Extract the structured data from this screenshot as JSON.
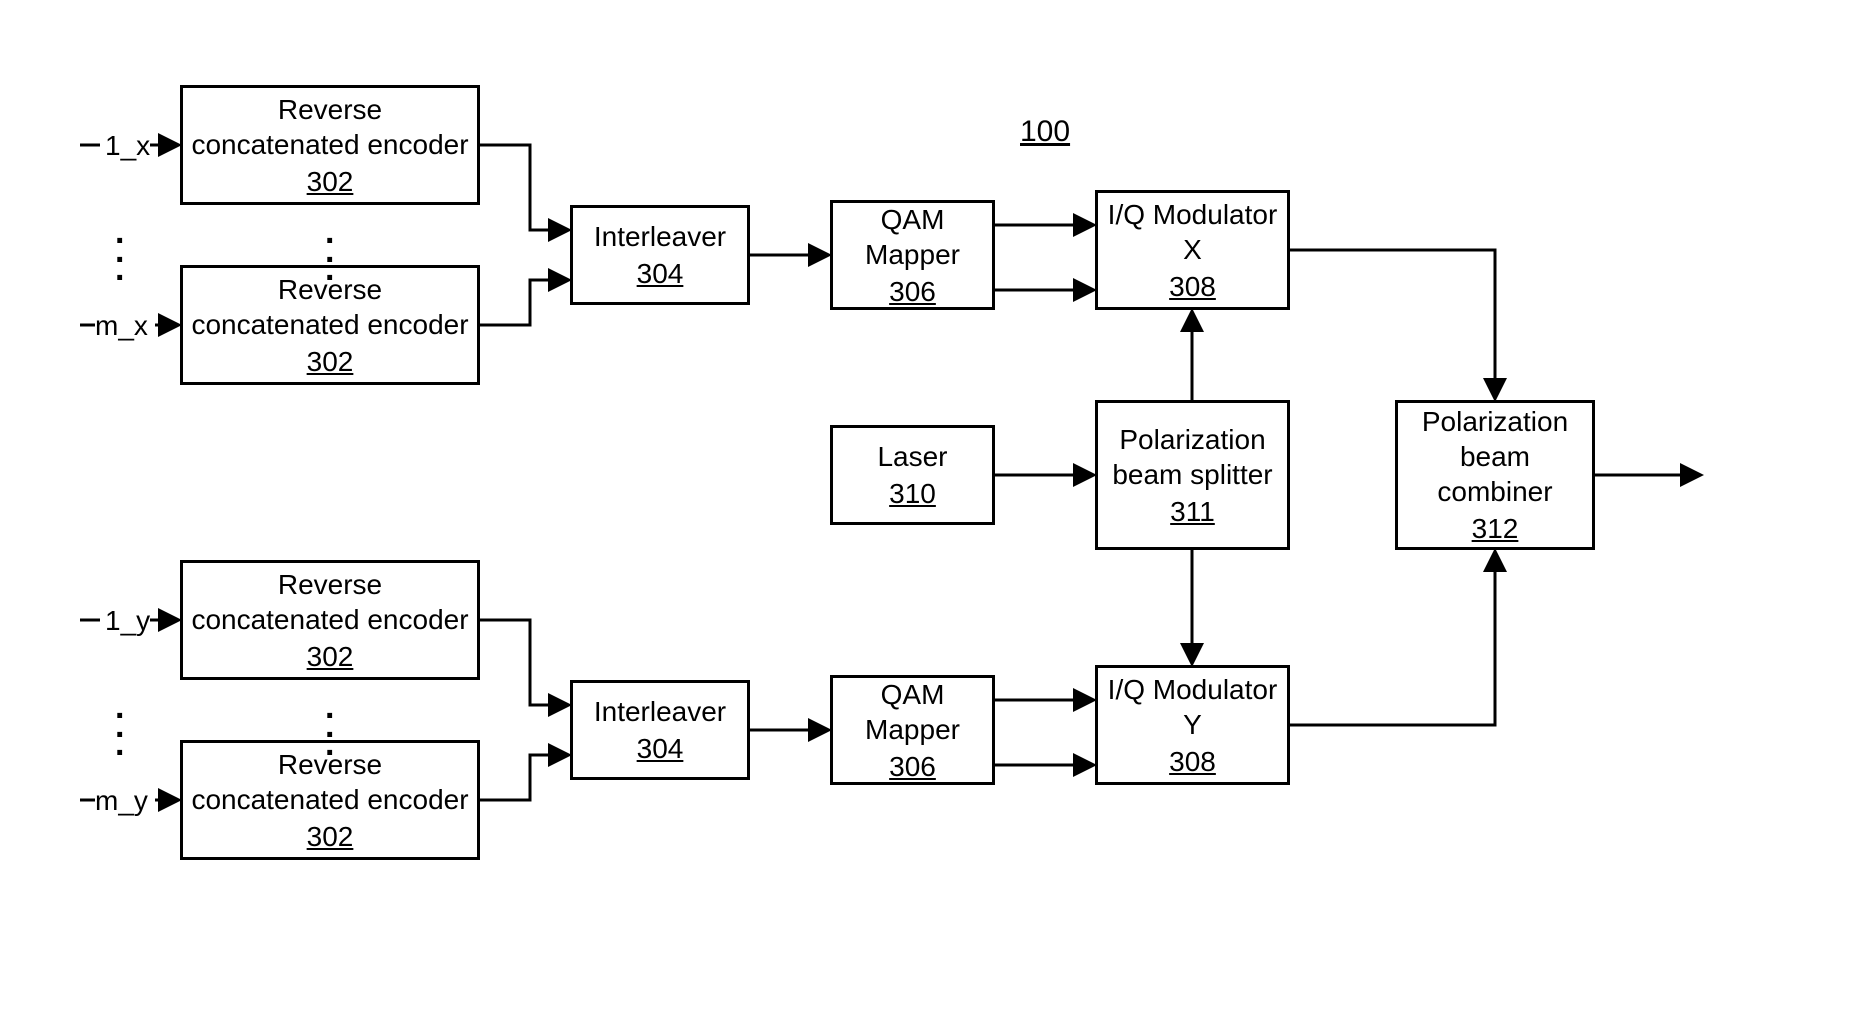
{
  "fig_ref": "100",
  "inputs": {
    "x_first": "1_x",
    "x_last": "m_x",
    "y_first": "1_y",
    "y_last": "m_y"
  },
  "blocks": {
    "encoder_x1": {
      "label": "Reverse concatenated encoder",
      "ref": "302"
    },
    "encoder_xm": {
      "label": "Reverse concatenated encoder",
      "ref": "302"
    },
    "encoder_y1": {
      "label": "Reverse concatenated encoder",
      "ref": "302"
    },
    "encoder_ym": {
      "label": "Reverse concatenated encoder",
      "ref": "302"
    },
    "interleaver_x": {
      "label": "Interleaver",
      "ref": "304"
    },
    "interleaver_y": {
      "label": "Interleaver",
      "ref": "304"
    },
    "mapper_x": {
      "label": "QAM Mapper",
      "ref": "306"
    },
    "mapper_y": {
      "label": "QAM Mapper",
      "ref": "306"
    },
    "mod_x": {
      "label": "I/Q Modulator X",
      "ref": "308"
    },
    "mod_y": {
      "label": "I/Q Modulator Y",
      "ref": "308"
    },
    "laser": {
      "label": "Laser",
      "ref": "310"
    },
    "splitter": {
      "label": "Polarization beam splitter",
      "ref": "311"
    },
    "combiner": {
      "label": "Polarization beam combiner",
      "ref": "312"
    }
  }
}
